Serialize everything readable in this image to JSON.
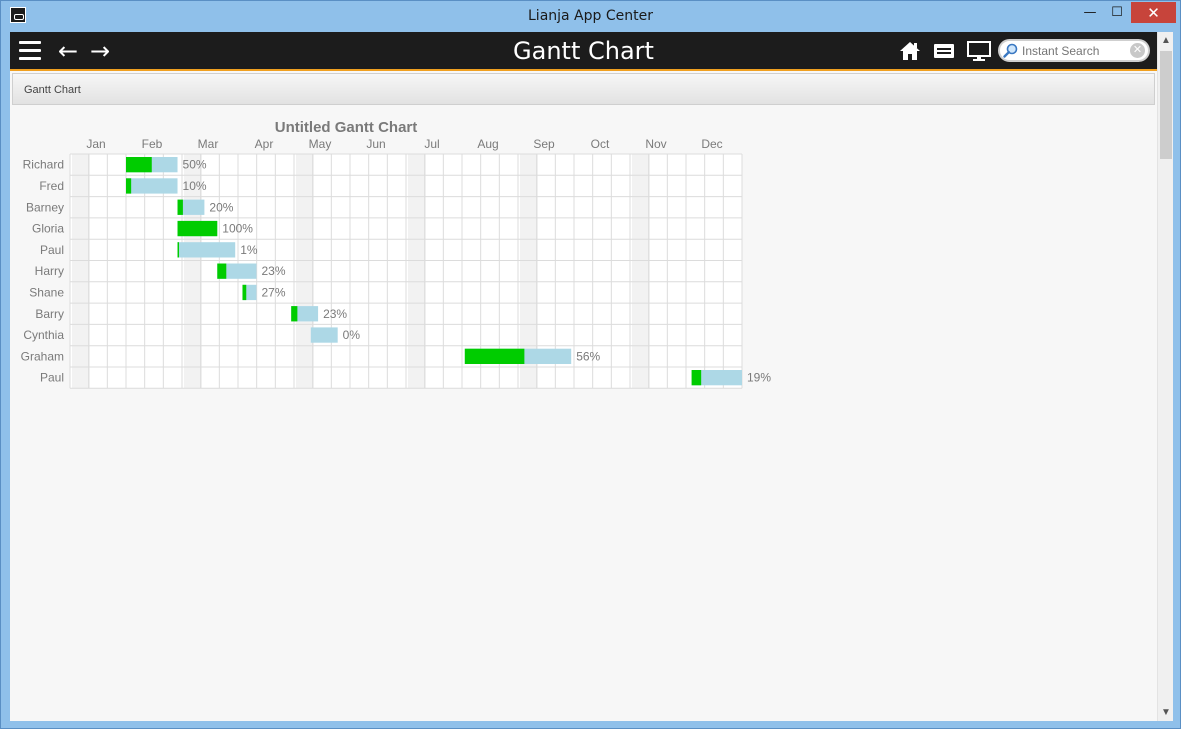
{
  "window": {
    "title": "Lianja App Center",
    "minimize_glyph": "—",
    "maximize_glyph": "☐",
    "close_glyph": "✕"
  },
  "toolbar": {
    "title": "Gantt Chart",
    "back_glyph": "←",
    "forward_glyph": "→",
    "icons": [
      "menu-icon",
      "back-arrow-icon",
      "forward-arrow-icon",
      "home-icon",
      "message-icon",
      "screen-icon"
    ]
  },
  "search": {
    "placeholder": "Instant Search",
    "clear_glyph": "✕"
  },
  "breadcrumb": {
    "text": "Gantt Chart"
  },
  "scrollbar": {
    "up_glyph": "▲",
    "down_glyph": "▼"
  },
  "colors": {
    "progress": "#00cc00",
    "remaining": "#add8e6",
    "toolbar": "#1c1c1c",
    "accent": "#f0a020",
    "close": "#c7443b"
  },
  "chart_data": {
    "type": "gantt",
    "title": "Untitled Gantt Chart",
    "x_axis": {
      "unit": "month",
      "labels": [
        "Jan",
        "Feb",
        "Mar",
        "Apr",
        "May",
        "Jun",
        "Jul",
        "Aug",
        "Sep",
        "Oct",
        "Nov",
        "Dec"
      ],
      "range": [
        0,
        12
      ]
    },
    "grid": true,
    "rows": [
      {
        "name": "Richard",
        "start": 1.0,
        "end": 1.92,
        "percent": 50,
        "label": "50%"
      },
      {
        "name": "Fred",
        "start": 1.0,
        "end": 1.92,
        "percent": 10,
        "label": "10%"
      },
      {
        "name": "Barney",
        "start": 1.92,
        "end": 2.4,
        "percent": 20,
        "label": "20%"
      },
      {
        "name": "Gloria",
        "start": 1.92,
        "end": 2.63,
        "percent": 100,
        "label": "100%"
      },
      {
        "name": "Paul",
        "start": 1.92,
        "end": 2.95,
        "percent": 1,
        "label": "1%"
      },
      {
        "name": "Harry",
        "start": 2.63,
        "end": 3.33,
        "percent": 23,
        "label": "23%"
      },
      {
        "name": "Shane",
        "start": 3.08,
        "end": 3.33,
        "percent": 27,
        "label": "27%"
      },
      {
        "name": "Barry",
        "start": 3.95,
        "end": 4.43,
        "percent": 23,
        "label": "23%"
      },
      {
        "name": "Cynthia",
        "start": 4.3,
        "end": 4.78,
        "percent": 0,
        "label": "0%"
      },
      {
        "name": "Graham",
        "start": 7.05,
        "end": 8.95,
        "percent": 56,
        "label": "56%"
      },
      {
        "name": "Paul",
        "start": 11.1,
        "end": 12.0,
        "percent": 19,
        "label": "19%"
      }
    ]
  }
}
